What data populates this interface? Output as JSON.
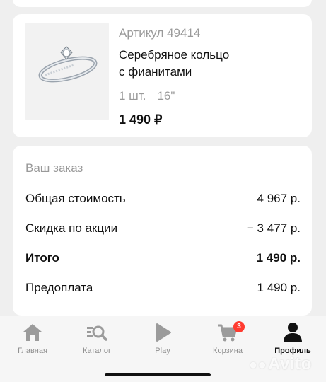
{
  "product": {
    "sku": "Артикул 49414",
    "title_line1": "Серебряное кольцо",
    "title_line2": "с фианитами",
    "quantity": "1 шт.",
    "size": "16\"",
    "price": "1 490 ₽",
    "image_icon": "ring-image"
  },
  "order": {
    "header": "Ваш заказ",
    "rows": [
      {
        "label": "Общая стоимость",
        "value": "4 967 р."
      },
      {
        "label": "Скидка по акции",
        "value": "− 3 477 р."
      },
      {
        "label": "Итого",
        "value": "1 490 р."
      },
      {
        "label": "Предоплата",
        "value": "1 490 р."
      }
    ]
  },
  "tabs": [
    {
      "label": "Главная",
      "icon": "home-icon"
    },
    {
      "label": "Каталог",
      "icon": "catalog-search-icon"
    },
    {
      "label": "Play",
      "icon": "play-icon"
    },
    {
      "label": "Корзина",
      "icon": "cart-icon",
      "badge": "3"
    },
    {
      "label": "Профиль",
      "icon": "profile-icon",
      "active": true
    }
  ],
  "watermark": "Avito",
  "colors": {
    "badge": "#ff3b30",
    "muted": "#9a9a9a",
    "background": "#efefef"
  }
}
